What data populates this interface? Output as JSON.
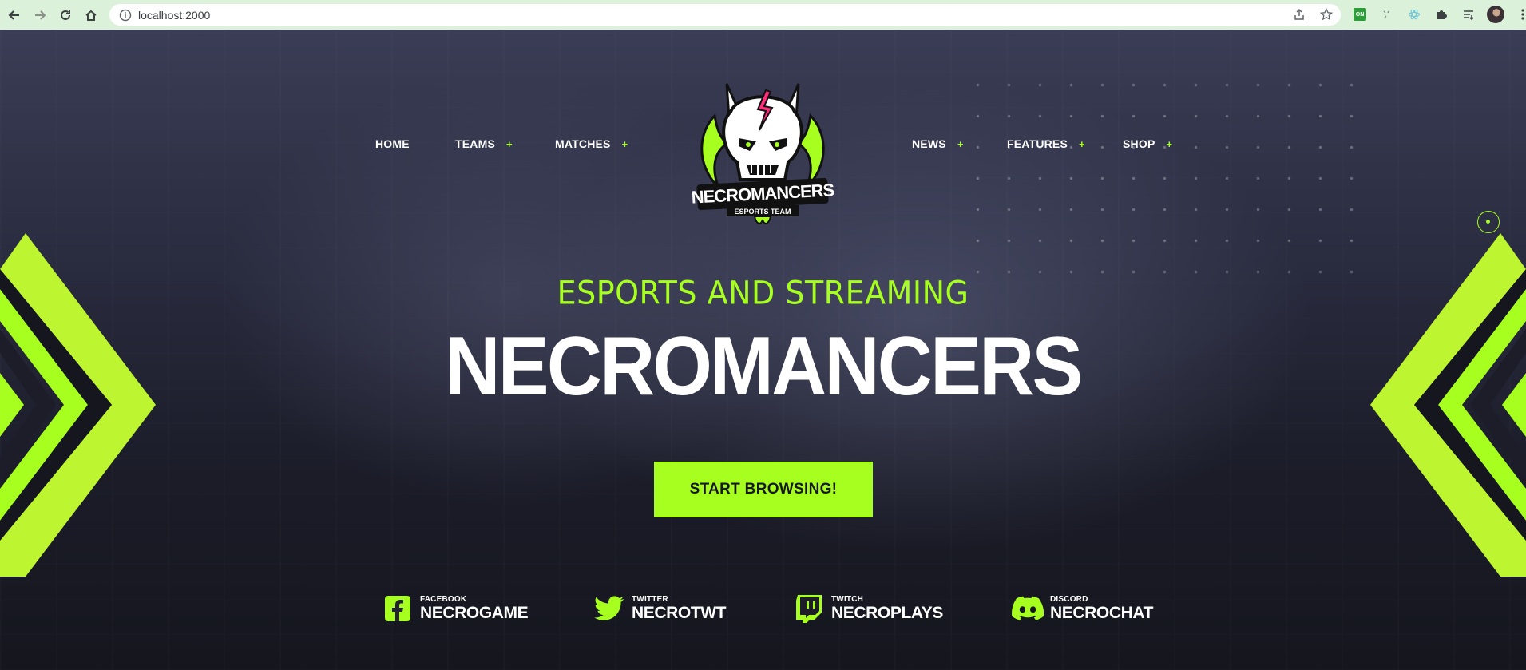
{
  "browser": {
    "url": "localhost:2000",
    "extension_badge": "ON"
  },
  "nav": {
    "left": [
      {
        "label": "HOME",
        "has_submenu": false
      },
      {
        "label": "TEAMS",
        "has_submenu": true
      },
      {
        "label": "MATCHES",
        "has_submenu": true
      }
    ],
    "right": [
      {
        "label": "NEWS",
        "has_submenu": true
      },
      {
        "label": "FEATURES",
        "has_submenu": true
      },
      {
        "label": "SHOP",
        "has_submenu": true
      }
    ],
    "submenu_marker": "+"
  },
  "logo": {
    "name": "NECROMANCERS",
    "subtitle": "ESPORTS TEAM"
  },
  "hero": {
    "tagline": "ESPORTS AND STREAMING",
    "title": "NECROMANCERS",
    "cta_label": "START BROWSING!"
  },
  "social": [
    {
      "network": "FACEBOOK",
      "handle": "NECROGAME",
      "icon": "facebook-icon"
    },
    {
      "network": "TWITTER",
      "handle": "NECROTWT",
      "icon": "twitter-icon"
    },
    {
      "network": "TWITCH",
      "handle": "NECROPLAYS",
      "icon": "twitch-icon"
    },
    {
      "network": "DISCORD",
      "handle": "NECROCHAT",
      "icon": "discord-icon"
    }
  ],
  "colors": {
    "accent": "#a6ff1e",
    "background": "#16171f",
    "text": "#ffffff"
  }
}
